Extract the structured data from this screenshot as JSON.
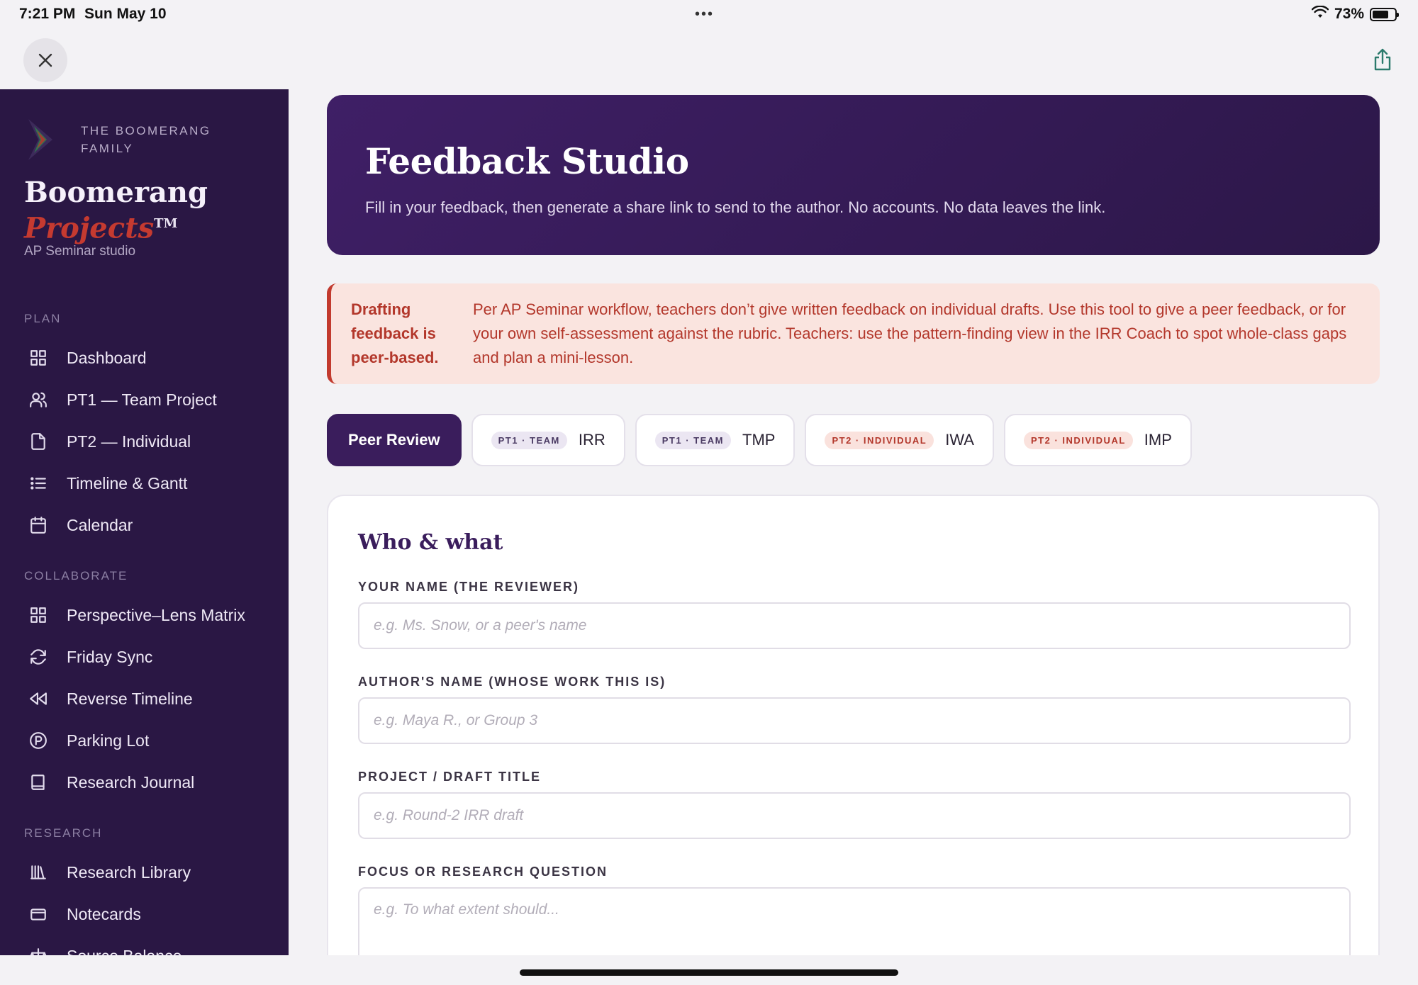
{
  "status": {
    "time": "7:21 PM",
    "date": "Sun May 10",
    "dots": "•••",
    "battery": "73%",
    "battery_level": 0.73
  },
  "sidebar": {
    "family": "THE BOOMERANG FAMILY",
    "title_line1": "Boomerang",
    "title_line2": "Projects",
    "tm": "TM",
    "subtitle": "AP Seminar studio",
    "sections": [
      {
        "label": "PLAN",
        "items": [
          {
            "label": "Dashboard",
            "icon": "grid-icon"
          },
          {
            "label": "PT1 — Team Project",
            "icon": "users-icon"
          },
          {
            "label": "PT2 — Individual",
            "icon": "file-icon"
          },
          {
            "label": "Timeline & Gantt",
            "icon": "list-icon"
          },
          {
            "label": "Calendar",
            "icon": "calendar-icon"
          }
        ]
      },
      {
        "label": "COLLABORATE",
        "items": [
          {
            "label": "Perspective–Lens Matrix",
            "icon": "grid-icon"
          },
          {
            "label": "Friday Sync",
            "icon": "refresh-icon"
          },
          {
            "label": "Reverse Timeline",
            "icon": "rewind-icon"
          },
          {
            "label": "Parking Lot",
            "icon": "parking-icon"
          },
          {
            "label": "Research Journal",
            "icon": "book-icon"
          }
        ]
      },
      {
        "label": "RESEARCH",
        "items": [
          {
            "label": "Research Library",
            "icon": "library-icon"
          },
          {
            "label": "Notecards",
            "icon": "card-icon"
          },
          {
            "label": "Source Balance",
            "icon": "scale-icon"
          }
        ]
      }
    ]
  },
  "hero": {
    "title": "Feedback Studio",
    "subtitle": "Fill in your feedback, then generate a share link to send to the author. No accounts. No data leaves the link."
  },
  "notice": {
    "lead": "Drafting feedback is peer-based.",
    "body": "Per AP Seminar workflow, teachers don’t give written feedback on individual drafts. Use this tool to give a peer feedback, or for your own self-assessment against the rubric. Teachers: use the pattern-finding view in the IRR Coach to spot whole-class gaps and plan a mini-lesson."
  },
  "tabs": [
    {
      "label": "Peer Review",
      "badge": "",
      "active": true
    },
    {
      "label": "IRR",
      "badge": "PT1 · TEAM",
      "kind": "team"
    },
    {
      "label": "TMP",
      "badge": "PT1 · TEAM",
      "kind": "team"
    },
    {
      "label": "IWA",
      "badge": "PT2 · INDIVIDUAL",
      "kind": "indiv"
    },
    {
      "label": "IMP",
      "badge": "PT2 · INDIVIDUAL",
      "kind": "indiv"
    }
  ],
  "form": {
    "heading": "Who & what",
    "fields": [
      {
        "label": "YOUR NAME (THE REVIEWER)",
        "placeholder": "e.g. Ms. Snow, or a peer's name",
        "value": ""
      },
      {
        "label": "AUTHOR'S NAME (WHOSE WORK THIS IS)",
        "placeholder": "e.g. Maya R., or Group 3",
        "value": ""
      },
      {
        "label": "PROJECT / DRAFT TITLE",
        "placeholder": "e.g. Round-2 IRR draft",
        "value": ""
      },
      {
        "label": "FOCUS OR RESEARCH QUESTION",
        "placeholder": "e.g. To what extent should...",
        "value": ""
      }
    ]
  },
  "colors": {
    "sidebar_bg": "#2a1744",
    "hero_bg": "#3f1f66",
    "accent": "#3a1d5c",
    "warning": "#c23a2e",
    "warning_bg": "#fae4df"
  }
}
